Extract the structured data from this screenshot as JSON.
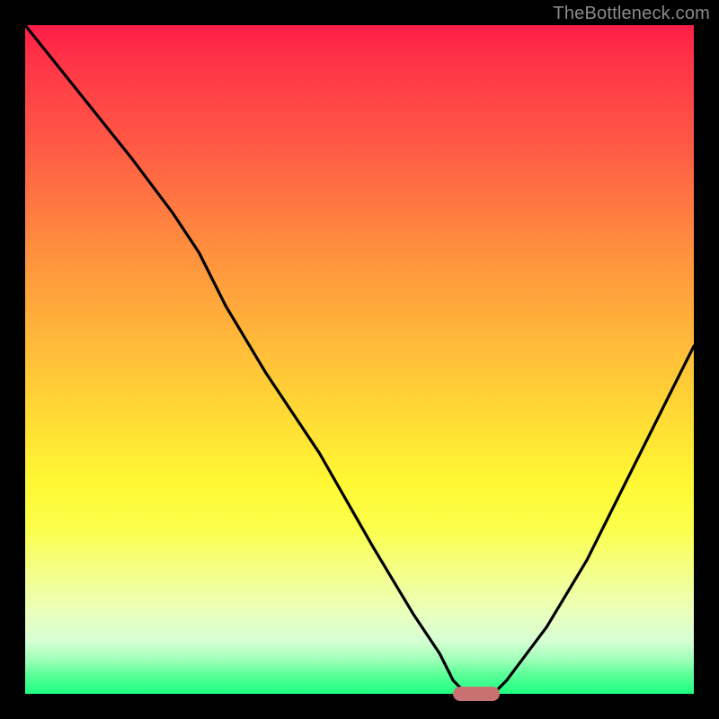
{
  "watermark": "TheBottleneck.com",
  "chart_data": {
    "type": "line",
    "title": "",
    "xlabel": "",
    "ylabel": "",
    "xlim": [
      0,
      100
    ],
    "ylim": [
      0,
      100
    ],
    "grid": false,
    "legend": false,
    "background": "red-yellow-green vertical gradient",
    "curve_points_xy": [
      [
        0,
        100
      ],
      [
        8,
        90
      ],
      [
        16,
        80
      ],
      [
        22,
        72
      ],
      [
        26,
        66
      ],
      [
        30,
        58
      ],
      [
        36,
        48
      ],
      [
        44,
        36
      ],
      [
        52,
        22
      ],
      [
        58,
        12
      ],
      [
        62,
        6
      ],
      [
        64,
        2
      ],
      [
        66,
        0
      ],
      [
        70,
        0
      ],
      [
        72,
        2
      ],
      [
        78,
        10
      ],
      [
        84,
        20
      ],
      [
        90,
        32
      ],
      [
        96,
        44
      ],
      [
        100,
        52
      ]
    ],
    "minimum_marker": {
      "x_start": 64,
      "x_end": 71,
      "y": 0,
      "color": "#c97070"
    },
    "series": [
      {
        "name": "bottleneck-curve",
        "color": "#000000"
      }
    ]
  }
}
